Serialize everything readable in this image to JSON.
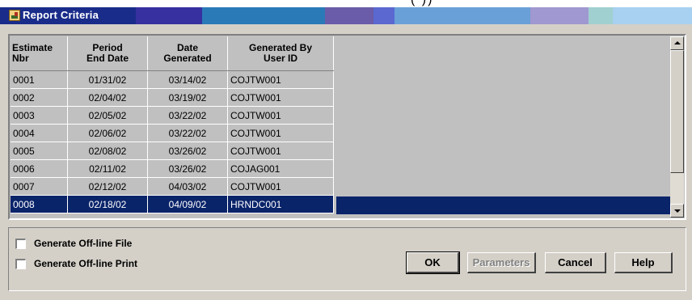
{
  "window": {
    "title": "Report Criteria",
    "title_overflow": "(                            ))",
    "title_colors": [
      "#1a2c8a",
      "#6c60b8",
      "#3630a0",
      "#2a7ab8",
      "#6a5ca8",
      "#5a78c8",
      "#6aa0d8",
      "#a098d0",
      "#a0d0d0",
      "#a8d0f0"
    ]
  },
  "grid": {
    "columns": [
      "Estimate Nbr",
      "Period End Date",
      "Date Generated",
      "Generated By User ID"
    ],
    "header_lines": [
      [
        "Estimate",
        "Nbr"
      ],
      [
        "Period",
        "End Date"
      ],
      [
        "Date",
        "Generated"
      ],
      [
        "Generated By",
        "User ID"
      ]
    ],
    "rows": [
      [
        "0001",
        "01/31/02",
        "03/14/02",
        "COJTW001"
      ],
      [
        "0002",
        "02/04/02",
        "03/19/02",
        "COJTW001"
      ],
      [
        "0003",
        "02/05/02",
        "03/22/02",
        "COJTW001"
      ],
      [
        "0004",
        "02/06/02",
        "03/22/02",
        "COJTW001"
      ],
      [
        "0005",
        "02/08/02",
        "03/26/02",
        "COJTW001"
      ],
      [
        "0006",
        "02/11/02",
        "03/26/02",
        "COJAG001"
      ],
      [
        "0007",
        "02/12/02",
        "04/03/02",
        "COJTW001"
      ],
      [
        "0008",
        "02/18/02",
        "04/09/02",
        "HRNDC001"
      ]
    ],
    "selected_row": 7
  },
  "options": {
    "offline_file_label": "Generate Off-line File",
    "offline_print_label": "Generate Off-line Print",
    "offline_file_checked": false,
    "offline_print_checked": false
  },
  "buttons": {
    "ok": "OK",
    "parameters": "Parameters",
    "cancel": "Cancel",
    "help": "Help"
  },
  "colors": {
    "selection": "#0a246a",
    "face": "#d4d0c8"
  }
}
